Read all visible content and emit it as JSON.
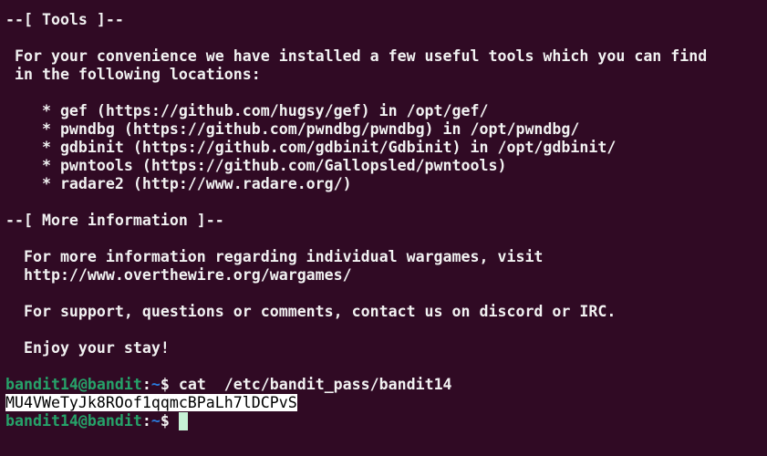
{
  "lines": [
    "--[ Tools ]--",
    "",
    " For your convenience we have installed a few useful tools which you can find",
    " in the following locations:",
    "",
    "    * gef (https://github.com/hugsy/gef) in /opt/gef/",
    "    * pwndbg (https://github.com/pwndbg/pwndbg) in /opt/pwndbg/",
    "    * gdbinit (https://github.com/gdbinit/Gdbinit) in /opt/gdbinit/",
    "    * pwntools (https://github.com/Gallopsled/pwntools)",
    "    * radare2 (http://www.radare.org/)",
    "",
    "--[ More information ]--",
    "",
    "  For more information regarding individual wargames, visit",
    "  http://www.overthewire.org/wargames/",
    "",
    "  For support, questions or comments, contact us on discord or IRC.",
    "",
    "  Enjoy your stay!",
    ""
  ],
  "prompt": {
    "user_host": "bandit14@bandit",
    "colon": ":",
    "cwd": "~",
    "symbol": "$ "
  },
  "command": "cat  /etc/bandit_pass/bandit14",
  "output": "MU4VWeTyJk8ROof1qqmcBPaLh7lDCPvS"
}
